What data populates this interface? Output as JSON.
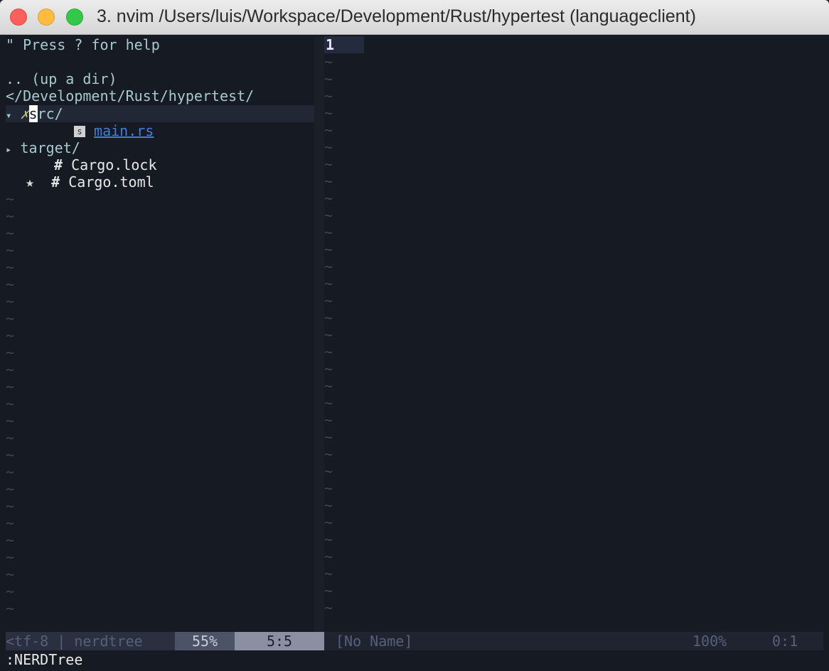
{
  "window": {
    "title": "3. nvim  /Users/luis/Workspace/Development/Rust/hypertest (languageclient)"
  },
  "nerdtree": {
    "help": "\" Press ? for help",
    "up_dir": ".. (up a dir)",
    "root": "</Development/Rust/hypertest/",
    "src": {
      "arrow": "▾",
      "git": "✗",
      "cursor_char": "s",
      "rest": "rc/"
    },
    "main_rs": {
      "badge": "s",
      "name": "main.rs"
    },
    "target": {
      "arrow": "▸",
      "name": "target/"
    },
    "cargo_lock": {
      "hash": "#",
      "name": "Cargo.lock"
    },
    "cargo_toml": {
      "star": "★",
      "hash": "#",
      "name": "Cargo.toml"
    },
    "tilde": "~"
  },
  "editor": {
    "line_number": "1",
    "tilde": "~"
  },
  "statusline": {
    "encoding": "<tf-8 | nerdtree",
    "percent": "55%",
    "position": "5:5",
    "buffer_name": "[No Name]",
    "percent_right": "100%",
    "position_right": "0:1"
  },
  "command_line": ":NERDTree",
  "colors": {
    "background": "#161a22",
    "tree_text": "#a7cad0",
    "link": "#3f80d6",
    "git_dirty": "#b6c07a"
  }
}
